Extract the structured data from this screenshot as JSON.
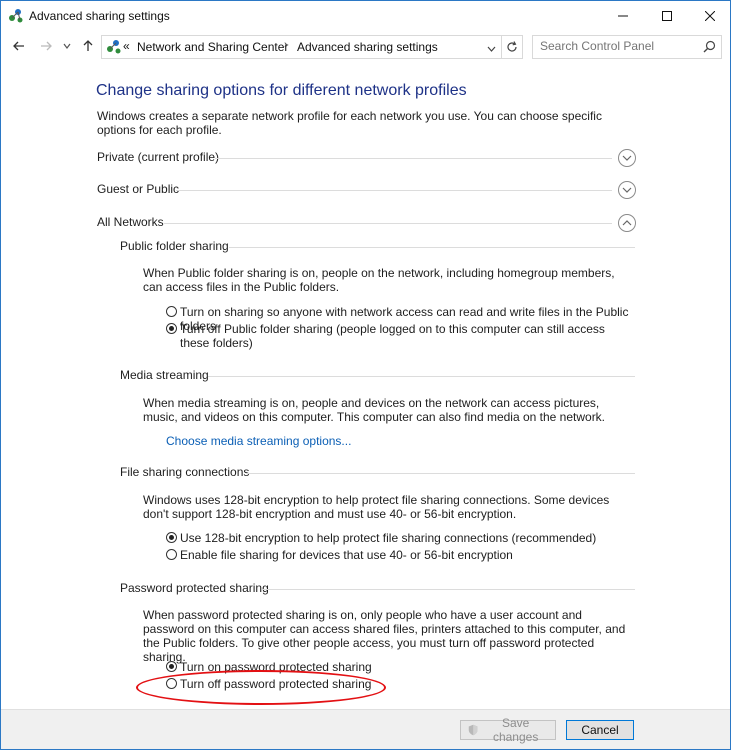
{
  "window": {
    "title": "Advanced sharing settings"
  },
  "address_bar": {
    "prefix": "«",
    "crumbs": [
      "Network and Sharing Center",
      "Advanced sharing settings"
    ]
  },
  "search": {
    "placeholder": "Search Control Panel"
  },
  "page": {
    "heading": "Change sharing options for different network profiles",
    "intro": "Windows creates a separate network profile for each network you use. You can choose specific options for each profile."
  },
  "profiles": [
    {
      "label": "Private (current profile)",
      "expanded": false
    },
    {
      "label": "Guest or Public",
      "expanded": false
    },
    {
      "label": "All Networks",
      "expanded": true
    }
  ],
  "sections": {
    "public_folder": {
      "title": "Public folder sharing",
      "description": "When Public folder sharing is on, people on the network, including homegroup members, can access files in the Public folders.",
      "options": [
        {
          "label": "Turn on sharing so anyone with network access can read and write files in the Public folders",
          "selected": false
        },
        {
          "label": "Turn off Public folder sharing (people logged on to this computer can still access these folders)",
          "selected": true
        }
      ]
    },
    "media_streaming": {
      "title": "Media streaming",
      "description": "When media streaming is on, people and devices on the network can access pictures, music, and videos on this computer. This computer can also find media on the network.",
      "link": "Choose media streaming options..."
    },
    "file_sharing": {
      "title": "File sharing connections",
      "description": "Windows uses 128-bit encryption to help protect file sharing connections. Some devices don't support 128-bit encryption and must use 40- or 56-bit encryption.",
      "options": [
        {
          "label": "Use 128-bit encryption to help protect file sharing connections (recommended)",
          "selected": true
        },
        {
          "label": "Enable file sharing for devices that use 40- or 56-bit encryption",
          "selected": false
        }
      ]
    },
    "password": {
      "title": "Password protected sharing",
      "description": "When password protected sharing is on, only people who have a user account and password on this computer can access shared files, printers attached to this computer, and the Public folders. To give other people access, you must turn off password protected sharing.",
      "options": [
        {
          "label": "Turn on password protected sharing",
          "selected": true
        },
        {
          "label": "Turn off password protected sharing",
          "selected": false
        }
      ]
    }
  },
  "footer": {
    "save_label": "Save changes",
    "cancel_label": "Cancel"
  },
  "colors": {
    "heading": "#1e3287",
    "link": "#0b5fb5",
    "annotation": "#e31013",
    "window_border": "#2b78c5"
  }
}
